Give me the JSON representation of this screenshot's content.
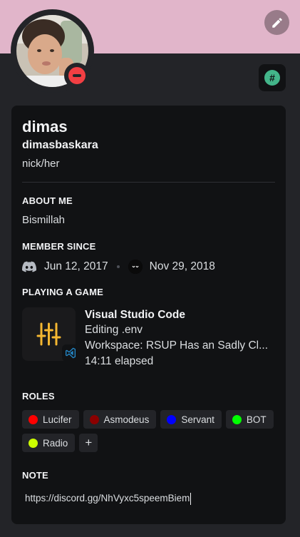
{
  "colors": {
    "banner": "#e1b5ca",
    "status_dnd": "#f23f43",
    "badge": "#43b58a",
    "vscode_accent": "#f4b731",
    "vscode_blue": "#2489ca"
  },
  "header": {
    "edit_icon": "pencil-icon",
    "status": "do-not-disturb",
    "badge_icon": "hashtag-icon",
    "badge_text": "#"
  },
  "profile": {
    "display_name": "dimas",
    "username": "dimasbaskara",
    "pronouns": "nick/her"
  },
  "about": {
    "title": "ABOUT ME",
    "text": "Bismillah"
  },
  "member_since": {
    "title": "MEMBER SINCE",
    "discord_date": "Jun 12, 2017",
    "server_date": "Nov 29, 2018"
  },
  "game": {
    "title": "PLAYING A GAME",
    "name": "Visual Studio Code",
    "details": "Editing .env",
    "state": "Workspace: RSUP Has an Sadly Cl...",
    "elapsed": "14:11 elapsed"
  },
  "roles": {
    "title": "ROLES",
    "items": [
      {
        "label": "Lucifer",
        "color": "#ff0000"
      },
      {
        "label": "Asmodeus",
        "color": "#8b0000"
      },
      {
        "label": "Servant",
        "color": "#0000ff"
      },
      {
        "label": "BOT",
        "color": "#00ff00"
      },
      {
        "label": "Radio",
        "color": "#ccff00"
      }
    ],
    "add_label": "+"
  },
  "note": {
    "title": "NOTE",
    "value": "https://discord.gg/NhVyxc5speemBiem"
  }
}
